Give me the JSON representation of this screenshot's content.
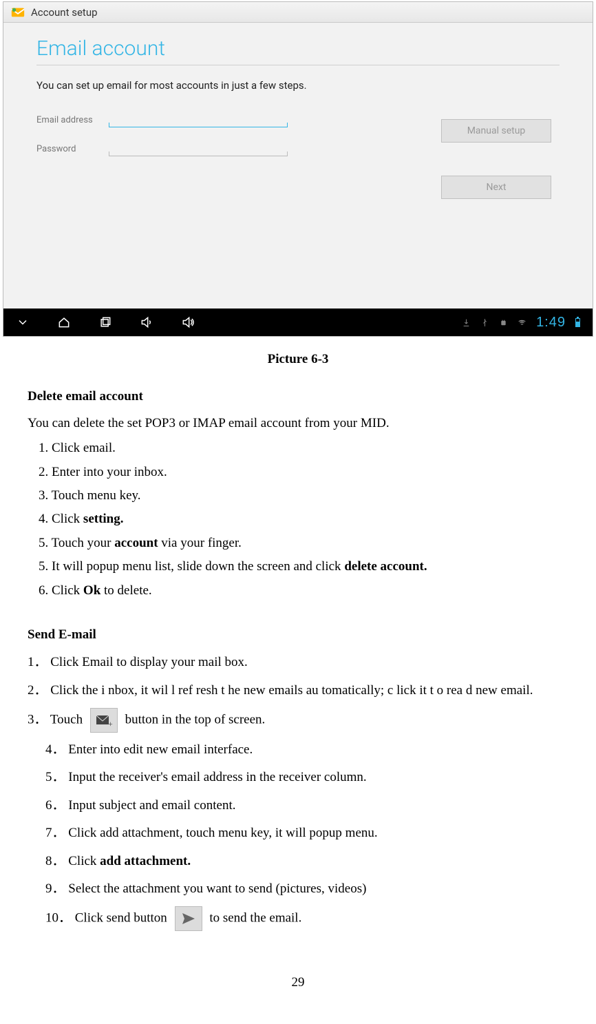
{
  "screenshot": {
    "topbar": {
      "title": "Account setup"
    },
    "email": {
      "title": "Email account",
      "subtitle": "You can set up email for most accounts in just a few steps.",
      "field_email_label": "Email address",
      "field_password_label": "Password"
    },
    "buttons": {
      "manual": "Manual setup",
      "next": "Next"
    },
    "clock": "1:49"
  },
  "caption": "Picture 6-3",
  "delete_section": {
    "heading": "Delete email account",
    "intro": "You can delete the set POP3 or IMAP email account from your MID.",
    "steps": {
      "s1": "1. Click email.",
      "s2": "2. Enter into your inbox.",
      "s3": "3. Touch menu key.",
      "s4_pre": "4. Click ",
      "s4_b": "setting.",
      "s5a_pre": "5. Touch your ",
      "s5a_b": "account",
      "s5a_post": " via your finger.",
      "s5b_pre": "5. It will popup menu list, slide down the screen and click ",
      "s5b_b": "delete account.",
      "s6_pre": "6. Click ",
      "s6_b": "Ok",
      "s6_post": " to delete."
    }
  },
  "send_section": {
    "heading": "Send E-mail",
    "s1": "1．  Click Email to display your mail box.",
    "s2": "2．  Click the i nbox, it wil l ref resh t he new  emails au tomatically; c lick it t o rea d new email.",
    "s3_pre": "3．  Touch",
    "s3_post": " button in the top of screen.",
    "s4": "4．  Enter into edit new email interface.",
    "s5": "5．  Input the receiver's email address in the receiver column.",
    "s6": "6．  Input subject and email content.",
    "s7": "7．  Click add attachment, touch menu key, it will popup menu.",
    "s8_pre": "8．   Click ",
    "s8_b": "add attachment.",
    "s9": "9．   Select the attachment you want to send (pictures, videos)",
    "s10_pre": "10．       Click send button ",
    "s10_post": " to send the email."
  },
  "page_number": "29"
}
